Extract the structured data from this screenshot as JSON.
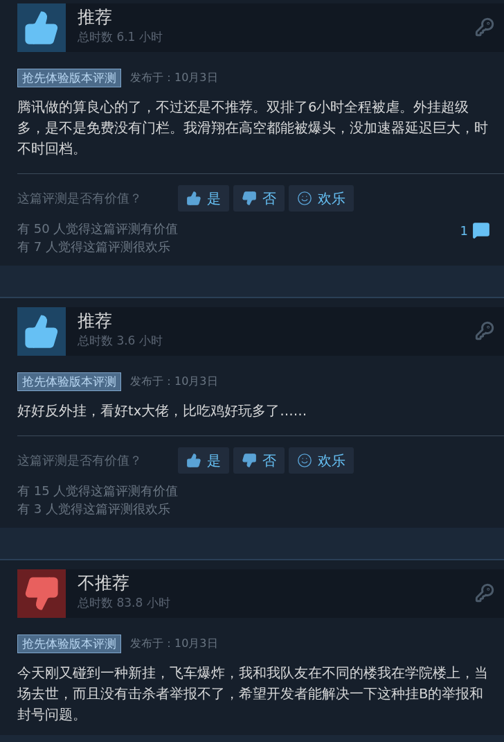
{
  "reviews": [
    {
      "kind": "recommended",
      "verdict": "推荐",
      "hours": "总时数 6.1 小时",
      "tag": "抢先体验版本评测",
      "posted": "发布于：10月3日",
      "text": "腾讯做的算良心的了，不过还是不推荐。双排了6小时全程被虐。外挂超级多，是不是免费没有门栏。我滑翔在高空都能被爆头，没加速器延迟巨大，时不时回档。",
      "question": "这篇评测是否有价值？",
      "buttons": [
        {
          "kind": "yes",
          "label": "是"
        },
        {
          "kind": "no",
          "label": "否"
        },
        {
          "kind": "funny",
          "label": "欢乐"
        }
      ],
      "stats": [
        "有 50 人觉得这篇评测有价值",
        "有 7 人觉得这篇评测很欢乐"
      ],
      "comments": "1"
    },
    {
      "kind": "recommended",
      "verdict": "推荐",
      "hours": "总时数 3.6 小时",
      "tag": "抢先体验版本评测",
      "posted": "发布于：10月3日",
      "text": "好好反外挂，看好tx大佬，比吃鸡好玩多了……",
      "question": "这篇评测是否有价值？",
      "buttons": [
        {
          "kind": "yes",
          "label": "是"
        },
        {
          "kind": "no",
          "label": "否"
        },
        {
          "kind": "funny",
          "label": "欢乐"
        }
      ],
      "stats": [
        "有 15 人觉得这篇评测有价值",
        "有 3 人觉得这篇评测很欢乐"
      ]
    },
    {
      "kind": "not_recommended",
      "verdict": "不推荐",
      "hours": "总时数 83.8 小时",
      "tag": "抢先体验版本评测",
      "posted": "发布于：10月3日",
      "text": "今天刚又碰到一种新挂，飞车爆炸，我和我队友在不同的楼我在学院楼上，当场去世，而且没有击杀者举报不了，希望开发者能解决一下这种挂B的举报和封号问题。"
    }
  ]
}
